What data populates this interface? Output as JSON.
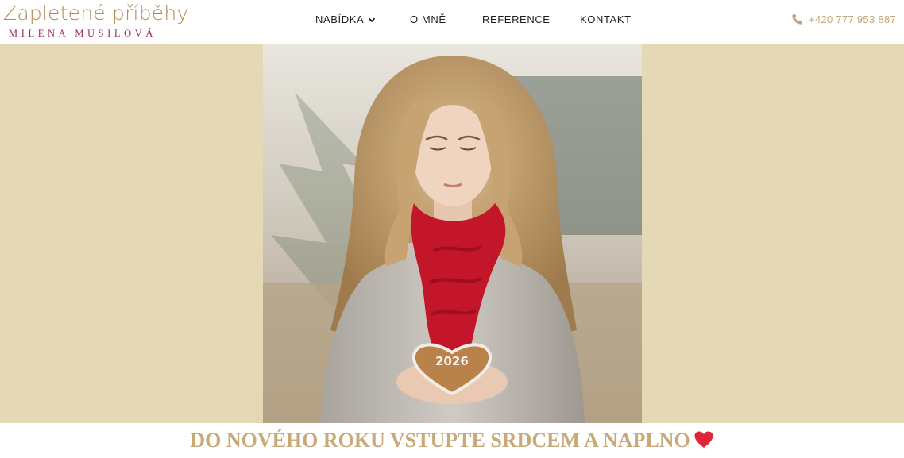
{
  "header": {
    "logo": {
      "title": "Zapletené příběhy",
      "subtitle": "MILENA MUSILOVÁ"
    },
    "nav": [
      {
        "label": "NABÍDKA",
        "icon": "chevron-down-icon"
      },
      {
        "label": "O MNĚ"
      },
      {
        "label": "REFERENCE"
      },
      {
        "label": "KONTAKT"
      }
    ],
    "phone": {
      "icon": "phone-icon",
      "number": "+420 777 953 887"
    }
  },
  "hero": {
    "image_alt": "Woman with red knitted scarf holding a heart-shaped gingerbread",
    "cookie_text": "2026"
  },
  "headline": {
    "text": "DO NOVÉHO ROKU VSTUPTE SRDCEM A NAPLNO",
    "icon": "heart-icon"
  },
  "colors": {
    "accent_gold": "#c8a978",
    "logo_gold": "#b08d57",
    "logo_magenta": "#9a2d63",
    "hero_bg": "#e5d8b5",
    "heart_red": "#e0253b",
    "scarf_red": "#c3162a"
  }
}
